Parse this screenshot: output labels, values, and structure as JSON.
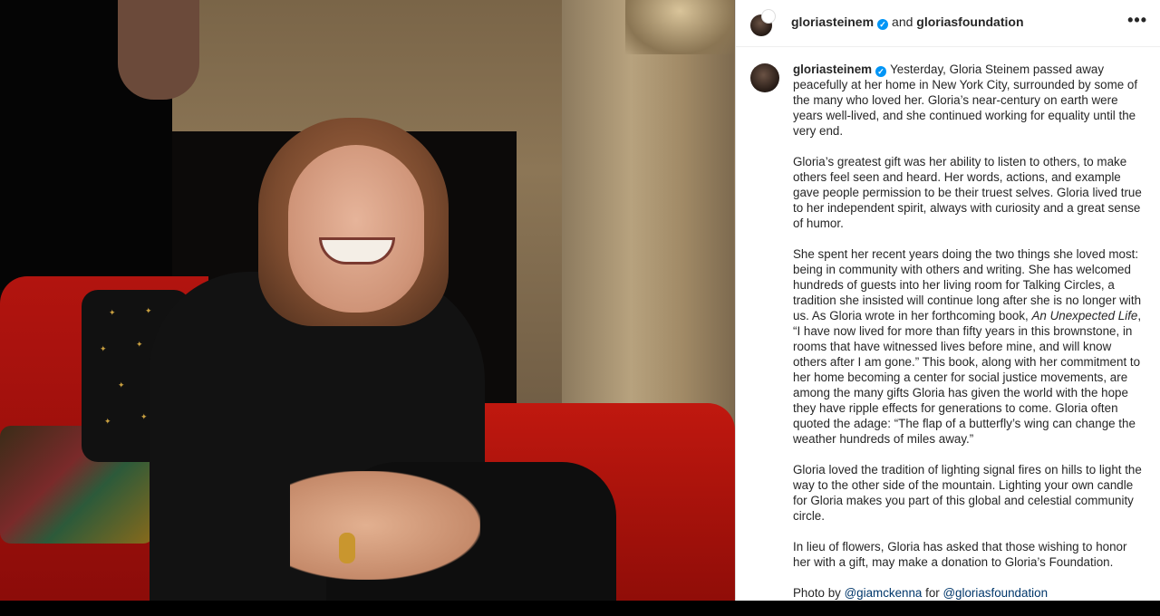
{
  "post": {
    "author": "gloriasteinem",
    "collaborator": "gloriasfoundation",
    "and_text": "and",
    "verified_mark": "✓",
    "more_icon": "ellipsis-icon",
    "more_label": "•••"
  },
  "caption": {
    "username": "gloriasteinem",
    "p1": "Yesterday, Gloria Steinem passed away peacefully at her home in New York City, surrounded by some of the many who loved her. Gloria’s near-century on earth were years well-lived, and she continued working for equality until the very end.",
    "p2": "Gloria’s greatest gift was her ability to listen to others, to make others feel seen and heard. Her words, actions, and example gave people permission to be their truest selves. Gloria lived true to her independent spirit, always with curiosity and a great sense of humor.",
    "p3_a": "She spent her recent years doing the two things she loved most: being in community with others and writing. She has welcomed hundreds of guests into her living room for Talking Circles, a tradition she insisted will continue long after she is no longer with us. As Gloria wrote in her forthcoming book, ",
    "p3_book": "An Unexpected Life",
    "p3_b": ", “I have now lived for more than fifty years in this brownstone, in rooms that have witnessed lives before mine, and will know others after I am gone.” This book, along with her commitment to her home becoming a center for social justice movements, are among the many gifts Gloria has given the world with the hope they have ripple effects for generations to come. Gloria often quoted the adage: “The flap of a butterfly’s wing can change the weather hundreds of miles away.”",
    "p4": "Gloria loved the tradition of lighting signal fires on hills to light the way to the other side of the mountain. Lighting your own candle for Gloria makes you part of this global and celestial community circle.",
    "p5": "In lieu of flowers, Gloria has asked that those wishing to honor her with a gift, may make a donation to Gloria’s Foundation.",
    "credit_prefix": "Photo by ",
    "credit_mention1": "@giamckenna",
    "credit_mid": " for ",
    "credit_mention2": "@gloriasfoundation"
  },
  "colors": {
    "verified": "#0095f6",
    "mention": "#00376b",
    "text": "#262626"
  }
}
